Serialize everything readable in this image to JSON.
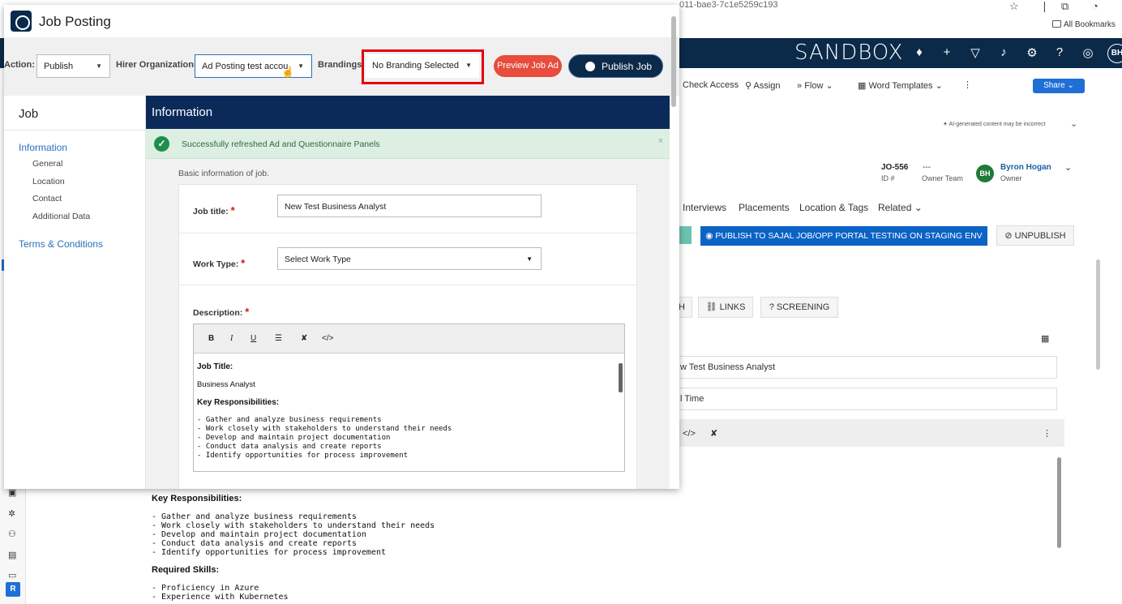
{
  "browser": {
    "url_fragment": "011-bae3-7c1e5259c193",
    "bookmarks_label": "All Bookmarks"
  },
  "app": {
    "brand": "SANDBOX",
    "nav_icons": [
      "lightbulb-icon",
      "plus-icon",
      "filter-icon",
      "bell-icon",
      "gear-icon",
      "help-icon",
      "apps-icon"
    ],
    "user_initials": "BH",
    "accent_color": "#0b2a4a"
  },
  "record_toolbar": {
    "check_access": "Check Access",
    "assign": "Assign",
    "flow": "Flow",
    "word_templates": "Word Templates",
    "share": "Share"
  },
  "record_header": {
    "ai_note": "AI-generated content may be incorrect",
    "job_number": "JO-556",
    "id_label": "ID #",
    "owner_team_value": "---",
    "owner_team_label": "Owner Team",
    "owner_initials": "BH",
    "owner_name": "Byron Hogan",
    "owner_label": "Owner"
  },
  "record_tabs": [
    "Interviews",
    "Placements",
    "Location & Tags",
    "Related"
  ],
  "record_actions": {
    "publish_portal": "PUBLISH TO SAJAL JOB/OPP PORTAL TESTING ON STAGING ENV",
    "unpublish": "UNPUBLISH",
    "links": "LINKS",
    "screening": "SCREENING",
    "chip_stub": "H"
  },
  "record_fields": {
    "title_fragment": "w Test Business Analyst",
    "worktype_fragment": "l Time"
  },
  "record_description": {
    "key_resp_heading": "Key Responsibilities:",
    "responsibilities": [
      "- Gather and analyze business requirements",
      "- Work closely with stakeholders to understand their needs",
      "- Develop and maintain project documentation",
      "- Conduct data analysis and create reports",
      "- Identify opportunities for process improvement"
    ],
    "skills_heading": "Required Skills:",
    "skills": [
      "- Proficiency in Azure",
      "- Experience with Kubernetes"
    ]
  },
  "modal": {
    "title": "Job Posting",
    "action_label": "Action:",
    "action_value": "Publish",
    "hirer_label": "Hirer Organizations:",
    "hirer_value": "Ad Posting test accou",
    "brandings_label": "Brandings:",
    "brandings_value": "No Branding Selected",
    "preview_button": "Preview Job Ad",
    "publish_button": "Publish Job",
    "sidebar": {
      "heading": "Job",
      "information": "Information",
      "subitems": [
        "General",
        "Location",
        "Contact",
        "Additional Data"
      ],
      "terms": "Terms & Conditions"
    },
    "section_title": "Information",
    "success_message": "Successfully refreshed Ad and Questionnaire Panels",
    "close_symbol": "×",
    "basic_info": "Basic information of job.",
    "form": {
      "job_title_label": "Job title:",
      "job_title_value": "New Test Business Analyst",
      "work_type_label": "Work Type:",
      "work_type_value": "Select Work Type",
      "description_label": "Description:",
      "required_mark": "*"
    },
    "editor": {
      "job_title_heading": "Job Title:",
      "job_title_text": "Business Analyst",
      "key_resp_heading": "Key Responsibilities:",
      "responsibilities": [
        "- Gather and analyze business requirements",
        "- Work closely with stakeholders to understand their needs",
        "- Develop and maintain project documentation",
        "- Conduct data analysis and create reports",
        "- Identify opportunities for process improvement"
      ]
    }
  }
}
